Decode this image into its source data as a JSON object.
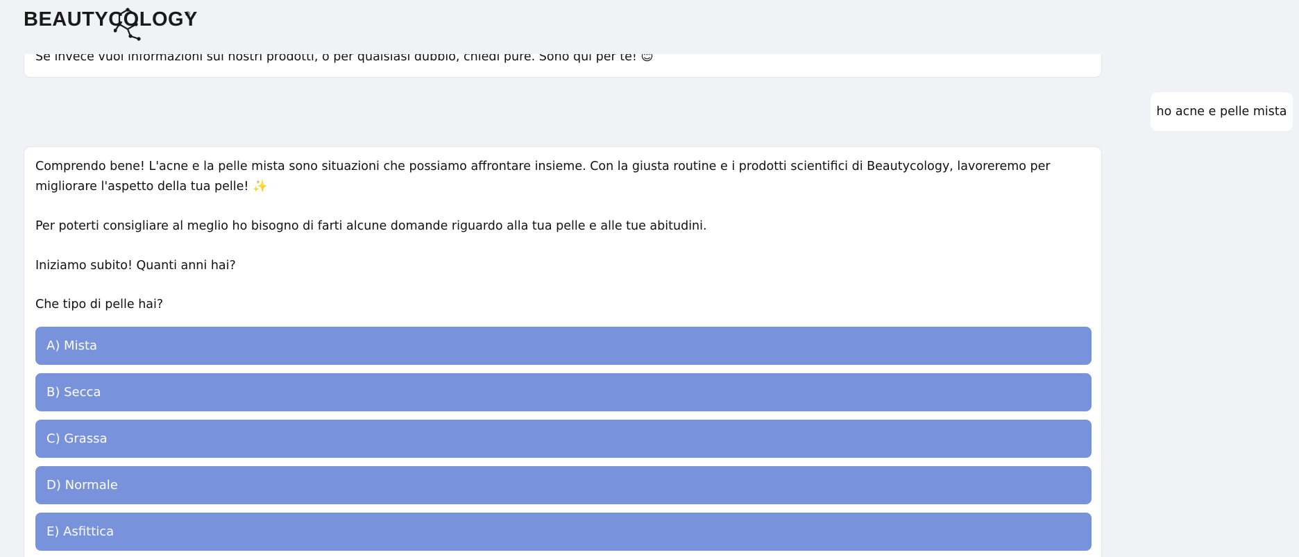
{
  "header": {
    "brand": "BEAUTYCOLOGY",
    "brand_mark": "®"
  },
  "chat": {
    "prev_bot_message": "Se invece vuoi informazioni sui nostri prodotti, o per qualsiasi dubbio, chiedi pure. Sono qui per te! 😊",
    "user_message": "ho acne e pelle mista",
    "bot_message": {
      "p1": "Comprendo bene! L'acne e la pelle mista sono situazioni che possiamo affrontare insieme. Con la giusta routine e i prodotti scientifici di Beautycology, lavoreremo per migliorare l'aspetto della tua pelle! ✨",
      "p2": "Per poterti consigliare al meglio ho bisogno di farti alcune domande riguardo alla tua pelle e alle tue abitudini.",
      "p3": "Iniziamo subito! Quanti anni hai?",
      "p4": "Che tipo di pelle hai?"
    },
    "options": [
      "A) Mista",
      "B) Secca",
      "C) Grassa",
      "D) Normale",
      "E) Asfittica"
    ]
  },
  "colors": {
    "page_bg": "#f1f2f5",
    "option_bg": "#7892dc",
    "bubble_bg": "#ffffff"
  }
}
